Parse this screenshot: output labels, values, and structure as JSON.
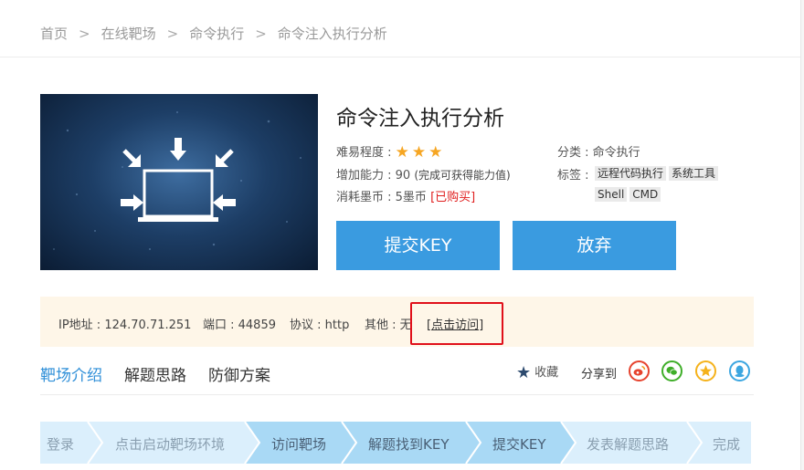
{
  "breadcrumb": [
    "首页",
    "在线靶场",
    "命令执行",
    "命令注入执行分析"
  ],
  "breadcrumb_sep": ">",
  "challenge": {
    "title": "命令注入执行分析",
    "difficulty_label": "难易程度 :",
    "difficulty_stars": 3,
    "ability_label": "增加能力 : 90",
    "ability_note": "(完成可获得能力值)",
    "cost_label": "消耗墨币 : 5墨币",
    "cost_status": "[已购买]",
    "category_label": "分类 : 命令执行",
    "tags_label": "标签 :",
    "tags": [
      "远程代码执行",
      "系统工具",
      "Shell",
      "CMD"
    ]
  },
  "buttons": {
    "submit": "提交KEY",
    "giveup": "放弃"
  },
  "target": {
    "ip": "IP地址 : 124.70.71.251",
    "port": "端口 : 44859",
    "protocol": "协议 : http",
    "other": "其他 : 无",
    "visit": "[点击访问]"
  },
  "tabs": [
    "靶场介绍",
    "解题思路",
    "防御方案"
  ],
  "active_tab": 0,
  "favorite_label": "收藏",
  "share_label": "分享到",
  "share_icons": [
    {
      "name": "weibo-share-icon",
      "color": "#e6432e"
    },
    {
      "name": "wechat-share-icon",
      "color": "#3fae29"
    },
    {
      "name": "qzone-share-icon",
      "color": "#f5b21b"
    },
    {
      "name": "qq-share-icon",
      "color": "#3ca6e0"
    }
  ],
  "steps": [
    "登录",
    "点击启动靶场环境",
    "访问靶场",
    "解题找到KEY",
    "提交KEY",
    "发表解题思路",
    "完成"
  ],
  "colors": {
    "accent": "#3a9be0",
    "step_dark": "#a9d9f5",
    "step_light": "#dbeffc",
    "highlight_box": "#e0101a",
    "info_bg": "#fef6e8"
  }
}
